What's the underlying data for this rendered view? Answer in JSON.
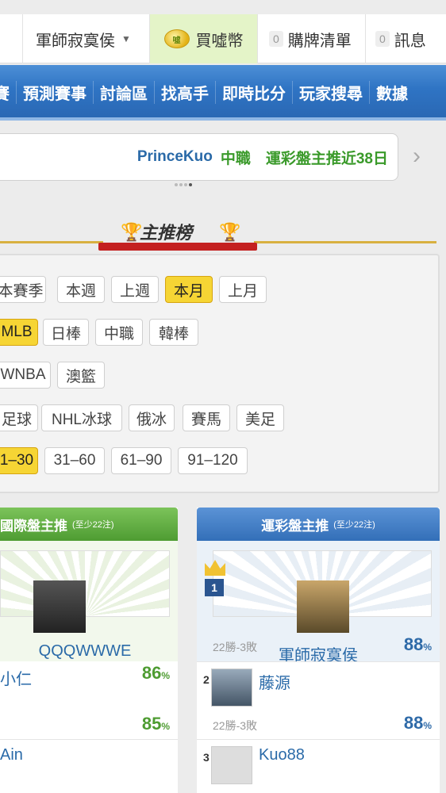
{
  "topbar": {
    "user": "軍師寂寞侯",
    "coin_label": "買噓幣",
    "coin_icon_text": "噓",
    "cart_count": "0",
    "cart_label": "購牌清單",
    "msg_count": "0",
    "msg_label": "訊息"
  },
  "nav": {
    "items": [
      "賽",
      "預測賽事",
      "討論區",
      "找高手",
      "即時比分",
      "玩家搜尋",
      "數據"
    ]
  },
  "banner": {
    "name": "PrinceKuo",
    "text": "中職　運彩盤主推近38日"
  },
  "ranking": {
    "title": "主推榜",
    "periods": [
      "本賽季",
      "本週",
      "上週",
      "本月",
      "上月"
    ],
    "active_period": "本月",
    "leagues_row1": [
      "MLB",
      "日棒",
      "中職",
      "韓棒"
    ],
    "active_league": "MLB",
    "leagues_row2": [
      "WNBA",
      "澳籃"
    ],
    "leagues_row3": [
      "足球",
      "NHL冰球",
      "俄冰",
      "賽馬",
      "美足"
    ],
    "ranges": [
      "1–30",
      "31–60",
      "61–90",
      "91–120"
    ],
    "active_range": "1–30"
  },
  "left_col": {
    "header": "國際盤主推",
    "header_note": "(至少22注)",
    "top_name": "QQQWWWE",
    "top_pct": "86",
    "second_name": "小仁",
    "second_pct": "85",
    "third_name": "Ain",
    "pct_unit": "%"
  },
  "right_col": {
    "header": "運彩盤主推",
    "header_note": "(至少22注)",
    "rank1": "1",
    "top_name": "軍師寂寞侯",
    "top_record": "22勝-3敗",
    "top_pct": "88",
    "rank2": "2",
    "second_name": "藤源",
    "second_record": "22勝-3敗",
    "second_pct": "88",
    "rank3": "3",
    "third_name": "Kuo88",
    "pct_unit": "%"
  }
}
